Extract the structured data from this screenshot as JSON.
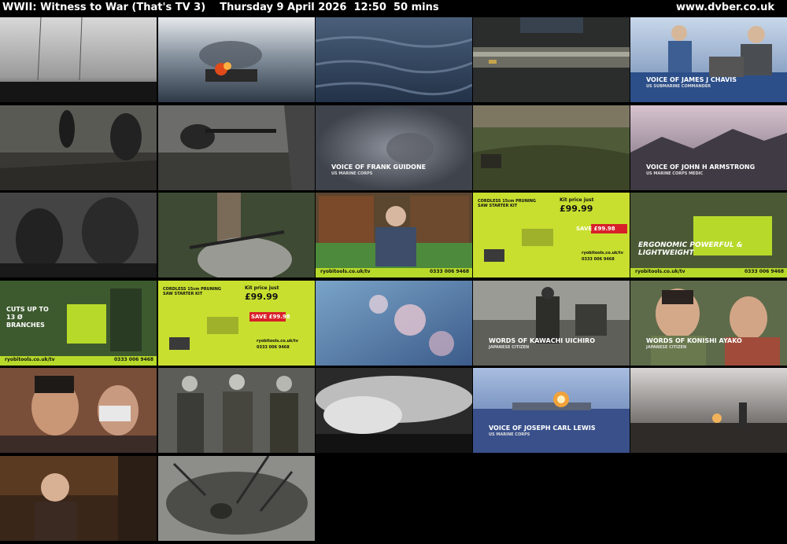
{
  "header": {
    "programme": "WWII: Witness to War (That's TV 3)",
    "date": "Thursday 9 April 2026",
    "time": "12:50",
    "duration": "50 mins",
    "site": "www.dvber.co.uk"
  },
  "thumbnails": [
    {
      "scene": "grey-sky-ocean"
    },
    {
      "scene": "burning-ship"
    },
    {
      "scene": "ocean-water"
    },
    {
      "scene": "submarine-gun"
    },
    {
      "scene": "binoculars-crew",
      "caption": "VOICE OF JAMES J CHAVIS",
      "subcaption": "US SUBMARINE COMMANDER"
    },
    {
      "scene": "soldiers-jungle"
    },
    {
      "scene": "soldier-rifle"
    },
    {
      "scene": "smoke-mist",
      "caption": "VOICE OF FRANK GUIDONE",
      "subcaption": "US MARINE CORPS"
    },
    {
      "scene": "field-jeep"
    },
    {
      "scene": "ruins",
      "caption": "VOICE OF JOHN H ARMSTRONG",
      "subcaption": "US MARINE CORPS MEDIC"
    },
    {
      "scene": "troops-dark"
    },
    {
      "scene": "saw-log"
    },
    {
      "scene": "ryobi-presenter",
      "url": "ryobitools.co.uk/tv",
      "phone": "0333 006 9468"
    },
    {
      "scene": "ryobi-offer",
      "headline": "CORDLESS 15cm PRUNING SAW STARTER KIT",
      "price_label": "Kit price just",
      "price": "£99.99",
      "save": "SAVE £99.98",
      "url": "ryobitools.co.uk/tv",
      "phone": "0333 006 9468"
    },
    {
      "scene": "ryobi-saw",
      "caption": "ERGONOMIC POWERFUL & LIGHTWEIGHT",
      "url": "ryobitools.co.uk/tv",
      "phone": "0333 006 9468"
    },
    {
      "scene": "ryobi-branches",
      "caption": "CUTS UP TO 13 Ø BRANCHES",
      "url": "ryobitools.co.uk/tv",
      "phone": "0333 006 9468"
    },
    {
      "scene": "ryobi-offer",
      "headline": "CORDLESS 15cm PRUNING SAW STARTER KIT",
      "price_label": "Kit price just",
      "price": "£99.99",
      "save": "SAVE £99.98",
      "url": "ryobitools.co.uk/tv",
      "phone": "0333 006 9468"
    },
    {
      "scene": "blossom"
    },
    {
      "scene": "horse-riders",
      "caption": "WORDS OF KAWACHI UICHIRO",
      "subcaption": "JAPANESE CITIZEN"
    },
    {
      "scene": "girl-portrait",
      "caption": "WORDS OF KONISHI AYAKO",
      "subcaption": "JAPANESE CITIZEN"
    },
    {
      "scene": "masked-women"
    },
    {
      "scene": "officers-group"
    },
    {
      "scene": "explosion-smoke"
    },
    {
      "scene": "fleet-explosion",
      "caption": "VOICE OF JOSEPH CARL LEWIS",
      "subcaption": "US MARINE CORPS"
    },
    {
      "scene": "sea-fire"
    },
    {
      "scene": "historian-library"
    },
    {
      "scene": "jungle-bw"
    }
  ]
}
